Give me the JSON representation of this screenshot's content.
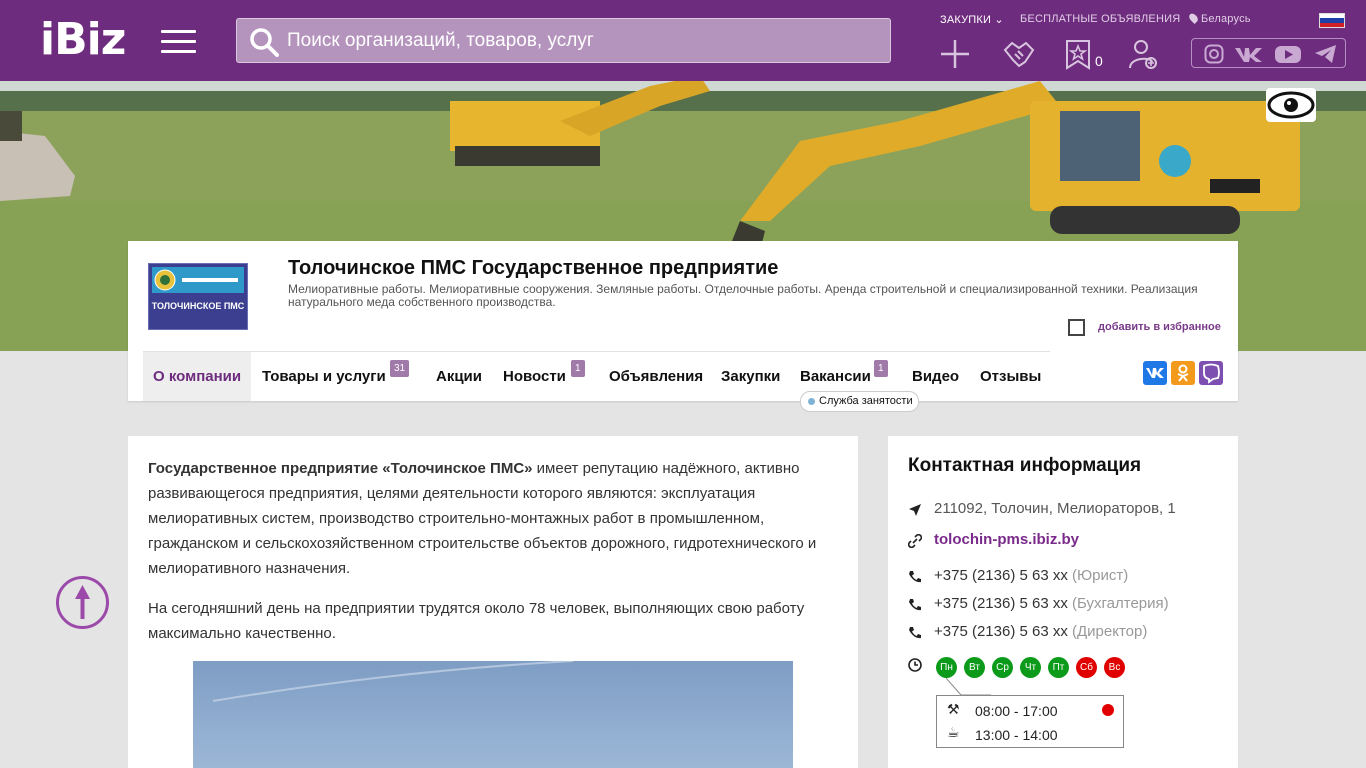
{
  "header": {
    "logo": "iBiz",
    "search_placeholder": "Поиск организаций, товаров, услуг",
    "links": [
      "ЗАКУПКИ",
      "БЕСПЛАТНЫЕ ОБЪЯВЛЕНИЯ",
      "Беларусь"
    ],
    "favorites_count": "0",
    "brand_color": "#6e2c7e"
  },
  "company": {
    "logo_text": "ТОЛОЧИНСКОЕ ПМС",
    "title": "Толочинское ПМС Государственное предприятие",
    "description": "Мелиоративные работы. Мелиоративные сооружения. Земляные работы. Отделочные работы. Аренда строительной и специализированной техники. Реализация натурального меда собственного производства.",
    "favorite_label": "добавить в избранное"
  },
  "nav": {
    "items": [
      {
        "label": "О компании",
        "badge": ""
      },
      {
        "label": "Товары и услуги",
        "badge": "31"
      },
      {
        "label": "Акции",
        "badge": ""
      },
      {
        "label": "Новости",
        "badge": "1"
      },
      {
        "label": "Объявления",
        "badge": ""
      },
      {
        "label": "Закупки",
        "badge": ""
      },
      {
        "label": "Вакансии",
        "badge": "1"
      },
      {
        "label": "Видео",
        "badge": ""
      },
      {
        "label": "Отзывы",
        "badge": ""
      }
    ],
    "vacancy_tag": "Служба занятости"
  },
  "about": {
    "p1_bold": "Государственное предприятие «Толочинское ПМС»",
    "p1_rest": " имеет репутацию надёжного, активно развивающегося предприятия, целями деятельности которого являются: эксплуатация мелиоративных систем, производство строительно-монтажных работ в промышленном, гражданском и сельскохозяйственном строительстве объектов дорожного, гидротехнического и мелиоративного назначения.",
    "p2": "На сегодняшний день на предприятии трудятся около 78 человек, выполняющих свою работу максимально качественно."
  },
  "contacts": {
    "title": "Контактная информация",
    "address": "211092, Толочин, Мелиораторов, 1",
    "website": "tolochin-pms.ibiz.by",
    "phones": [
      {
        "number": "+375 (2136) 5 63 xx",
        "role": "(Юрист)"
      },
      {
        "number": "+375 (2136) 5 63 xx",
        "role": "(Бухгалтерия)"
      },
      {
        "number": "+375 (2136) 5 63 xx",
        "role": "(Директор)"
      }
    ],
    "days": [
      {
        "label": "Пн",
        "color": "#0c9a1a"
      },
      {
        "label": "Вт",
        "color": "#0c9a1a"
      },
      {
        "label": "Ср",
        "color": "#0c9a1a"
      },
      {
        "label": "Чт",
        "color": "#0c9a1a"
      },
      {
        "label": "Пт",
        "color": "#0c9a1a"
      },
      {
        "label": "Сб",
        "color": "#e00000"
      },
      {
        "label": "Вс",
        "color": "#e00000"
      }
    ],
    "work_hours": "08:00 - 17:00",
    "lunch_hours": "13:00 - 14:00"
  }
}
